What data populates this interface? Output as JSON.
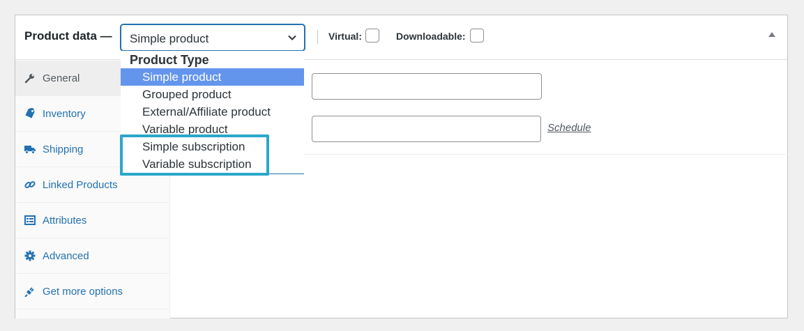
{
  "header": {
    "title": "Product data —",
    "product_type_select": {
      "value": "Simple product"
    },
    "virtual_label": "Virtual:",
    "downloadable_label": "Downloadable:"
  },
  "sidebar": {
    "tabs": [
      {
        "label": "General",
        "icon": "wrench-icon",
        "active": true
      },
      {
        "label": "Inventory",
        "icon": "tag-icon",
        "active": false
      },
      {
        "label": "Shipping",
        "icon": "truck-icon",
        "active": false
      },
      {
        "label": "Linked Products",
        "icon": "link-icon",
        "active": false
      },
      {
        "label": "Attributes",
        "icon": "list-view-icon",
        "active": false
      },
      {
        "label": "Advanced",
        "icon": "gear-icon",
        "active": false
      },
      {
        "label": "Get more options",
        "icon": "plugin-icon",
        "active": false
      }
    ]
  },
  "main": {
    "schedule_link": "Schedule"
  },
  "dropdown": {
    "group_label": "Product Type",
    "options": [
      "Simple product",
      "Grouped product",
      "External/Affiliate product",
      "Variable product",
      "Simple subscription",
      "Variable subscription"
    ],
    "selected": "Simple product"
  },
  "colors": {
    "accent": "#2271b1",
    "selected_option_bg": "#6495ed",
    "highlight_border": "#2aa7c9"
  }
}
